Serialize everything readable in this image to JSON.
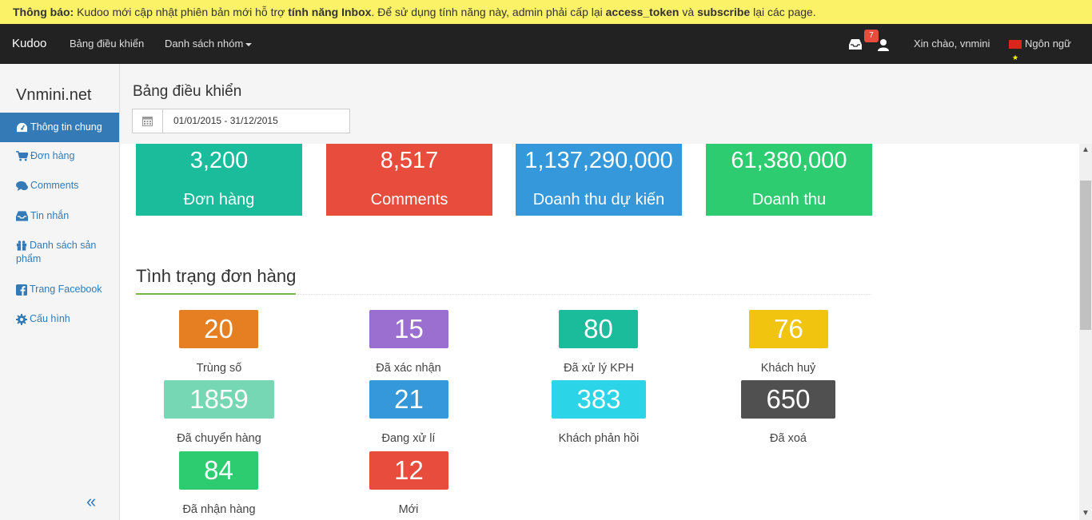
{
  "notice": {
    "prefix": "Thông báo:",
    "text1": " Kudoo mới cập nhật phiên bản mới hỗ trợ ",
    "feature": "tính năng Inbox",
    "text2": ". Để sử dụng tính năng này, admin phải cấp lại ",
    "token": "access_token",
    "text3": " và ",
    "subscribe": "subscribe",
    "text4": " lại các page."
  },
  "navbar": {
    "brand": "Kudoo",
    "dashboard": "Bảng điều khiển",
    "groups": "Danh sách nhóm",
    "inbox_badge": "7",
    "greeting": "Xin chào, vnmini",
    "language": "Ngôn ngữ"
  },
  "sidebar": {
    "site": "Vnmini.net",
    "items": [
      {
        "label": "Thông tin chung",
        "icon": "dashboard-icon"
      },
      {
        "label": "Đơn hàng",
        "icon": "cart-icon"
      },
      {
        "label": "Comments",
        "icon": "comments-icon"
      },
      {
        "label": "Tin nhắn",
        "icon": "inbox-icon"
      },
      {
        "label": "Danh sách sản phẩm",
        "icon": "gift-icon"
      },
      {
        "label": "Trang Facebook",
        "icon": "facebook-icon"
      },
      {
        "label": "Cấu hình",
        "icon": "gear-icon"
      }
    ],
    "collapse": "«"
  },
  "header": {
    "title": "Bảng điều khiển",
    "date_range": "01/01/2015 - 31/12/2015"
  },
  "stats": [
    {
      "value": "3,200",
      "label": "Đơn hàng",
      "color": "#1abc9c"
    },
    {
      "value": "8,517",
      "label": "Comments",
      "color": "#e74c3c"
    },
    {
      "value": "1,137,290,000",
      "label": "Doanh thu dự kiến",
      "color": "#3498db"
    },
    {
      "value": "61,380,000",
      "label": "Doanh thu",
      "color": "#2ecc71"
    }
  ],
  "order_status": {
    "title": "Tình trạng đơn hàng",
    "items": [
      {
        "value": "20",
        "label": "Trùng số",
        "color": "#e67e22"
      },
      {
        "value": "15",
        "label": "Đã xác nhận",
        "color": "#9b6fcf"
      },
      {
        "value": "80",
        "label": "Đã xử lý KPH",
        "color": "#1abc9c"
      },
      {
        "value": "76",
        "label": "Khách huỷ",
        "color": "#f1c40f"
      },
      {
        "value": "1859",
        "label": "Đã chuyển hàng",
        "color": "#76d7b4"
      },
      {
        "value": "21",
        "label": "Đang xử lí",
        "color": "#3498db"
      },
      {
        "value": "383",
        "label": "Khách phản hồi",
        "color": "#2cd4e8"
      },
      {
        "value": "650",
        "label": "Đã xoá",
        "color": "#505050"
      },
      {
        "value": "84",
        "label": "Đã nhận hàng",
        "color": "#2ecc71"
      },
      {
        "value": "12",
        "label": "Mới",
        "color": "#e74c3c"
      }
    ]
  }
}
